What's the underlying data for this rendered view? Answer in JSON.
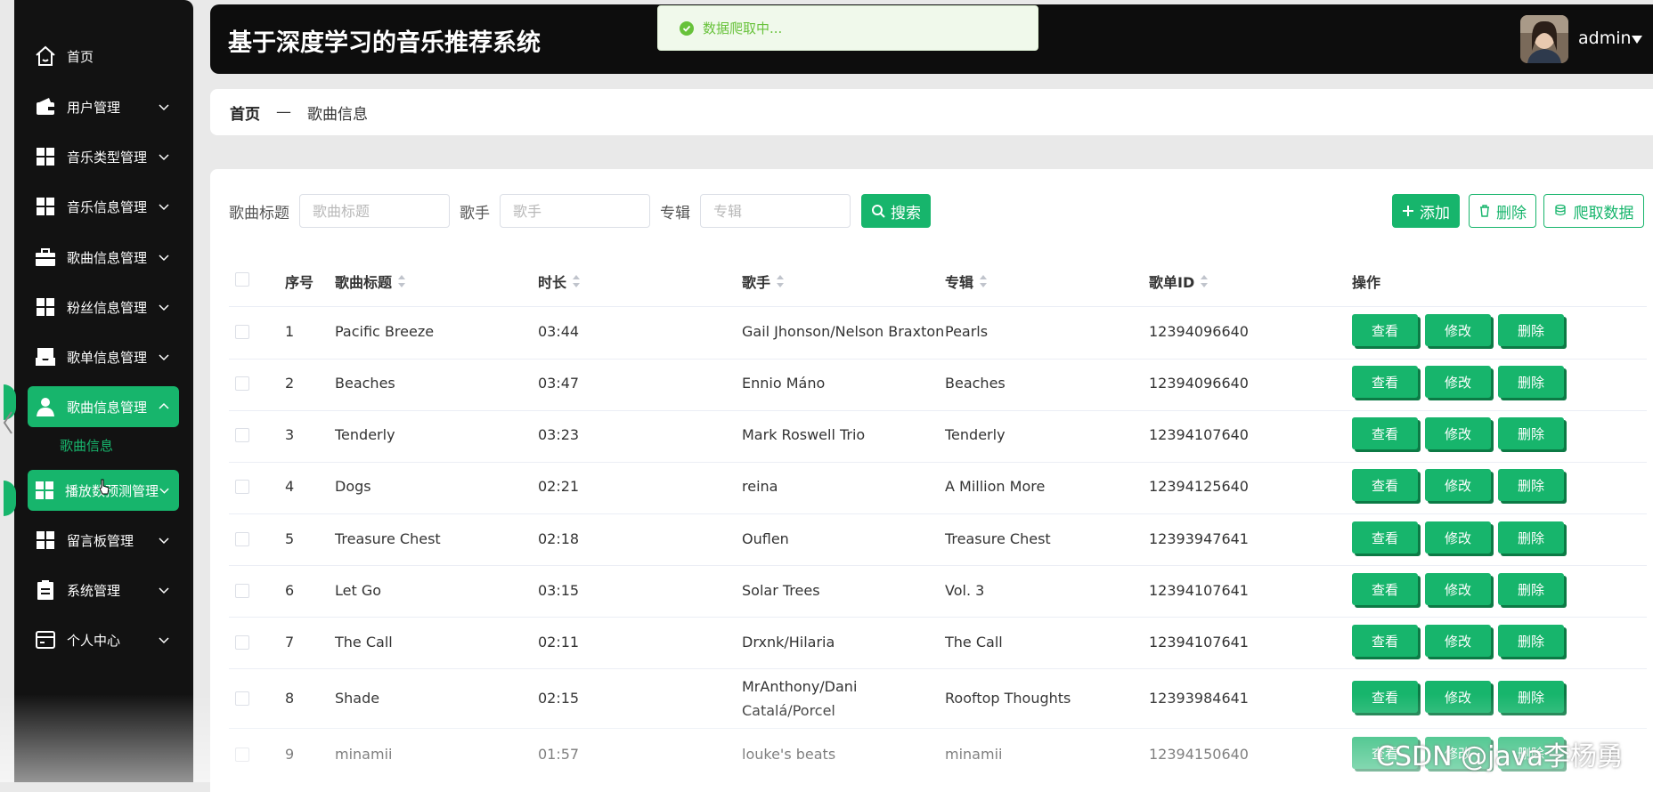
{
  "sidebar": {
    "items": [
      {
        "label": "首页",
        "icon": "home-icon",
        "chevron": false,
        "active": false
      },
      {
        "label": "用户管理",
        "icon": "wallet-icon",
        "chevron": true,
        "active": false
      },
      {
        "label": "音乐类型管理",
        "icon": "grid-icon",
        "chevron": true,
        "active": false
      },
      {
        "label": "音乐信息管理",
        "icon": "grid-icon",
        "chevron": true,
        "active": false
      },
      {
        "label": "歌曲信息管理",
        "icon": "briefcase-icon",
        "chevron": true,
        "active": false
      },
      {
        "label": "粉丝信息管理",
        "icon": "grid-icon",
        "chevron": true,
        "active": false
      },
      {
        "label": "歌单信息管理",
        "icon": "inbox-icon",
        "chevron": true,
        "active": false
      },
      {
        "label": "歌曲信息管理",
        "icon": "user-icon",
        "chevron": true,
        "active": true,
        "expanded": true
      },
      {
        "label": "播放数预测管理",
        "icon": "grid-icon",
        "chevron": true,
        "active": true
      },
      {
        "label": "留言板管理",
        "icon": "grid-icon",
        "chevron": true,
        "active": false
      },
      {
        "label": "系统管理",
        "icon": "clipboard-icon",
        "chevron": true,
        "active": false
      },
      {
        "label": "个人中心",
        "icon": "card-icon",
        "chevron": true,
        "active": false
      }
    ],
    "sub_item": "歌曲信息"
  },
  "header": {
    "title": "基于深度学习的音乐推荐系统",
    "user": "admin"
  },
  "toast": {
    "text": "数据爬取中..."
  },
  "breadcrumb": {
    "home": "首页",
    "sep": "—",
    "current": "歌曲信息"
  },
  "filters": {
    "title_label": "歌曲标题",
    "title_placeholder": "歌曲标题",
    "singer_label": "歌手",
    "singer_placeholder": "歌手",
    "album_label": "专辑",
    "album_placeholder": "专辑",
    "search_label": "搜索"
  },
  "actions": {
    "add": "添加",
    "delete": "删除",
    "crawl": "爬取数据"
  },
  "table": {
    "headers": {
      "index": "序号",
      "title": "歌曲标题",
      "duration": "时长",
      "singer": "歌手",
      "album": "专辑",
      "playlist_id": "歌单ID",
      "ops": "操作"
    },
    "row_buttons": {
      "view": "查看",
      "edit": "修改",
      "delete": "删除"
    },
    "rows": [
      {
        "index": "1",
        "title": "Pacific Breeze",
        "duration": "03:44",
        "singer": "Gail Jhonson/Nelson Braxton",
        "album": "Pearls",
        "playlist_id": "12394096640"
      },
      {
        "index": "2",
        "title": "Beaches",
        "duration": "03:47",
        "singer": "Ennio Máno",
        "album": "Beaches",
        "playlist_id": "12394096640"
      },
      {
        "index": "3",
        "title": "Tenderly",
        "duration": "03:23",
        "singer": "Mark Roswell Trio",
        "album": "Tenderly",
        "playlist_id": "12394107640"
      },
      {
        "index": "4",
        "title": "Dogs",
        "duration": "02:21",
        "singer": "reina",
        "album": "A Million More",
        "playlist_id": "12394125640"
      },
      {
        "index": "5",
        "title": "Treasure Chest",
        "duration": "02:18",
        "singer": "Ouflen",
        "album": "Treasure Chest",
        "playlist_id": "12393947641"
      },
      {
        "index": "6",
        "title": "Let Go",
        "duration": "03:15",
        "singer": "Solar Trees",
        "album": "Vol. 3",
        "playlist_id": "12394107641"
      },
      {
        "index": "7",
        "title": "The Call",
        "duration": "02:11",
        "singer": "Drxnk/Hilaria",
        "album": "The Call",
        "playlist_id": "12394107641"
      },
      {
        "index": "8",
        "title": "Shade",
        "duration": "02:15",
        "singer": "MrAnthony/Dani Catalá/Porcel",
        "album": "Rooftop Thoughts",
        "playlist_id": "12393984641"
      },
      {
        "index": "9",
        "title": "minamii",
        "duration": "01:57",
        "singer": "louke's beats",
        "album": "minamii",
        "playlist_id": "12394150640"
      }
    ]
  },
  "watermark": "CSDN @java李杨勇",
  "colors": {
    "accent": "#17b56c",
    "sidebar_bg": "#121212",
    "header_bg": "#0d0d0d",
    "toast_bg": "#f0f9eb",
    "toast_text": "#67c23a"
  }
}
